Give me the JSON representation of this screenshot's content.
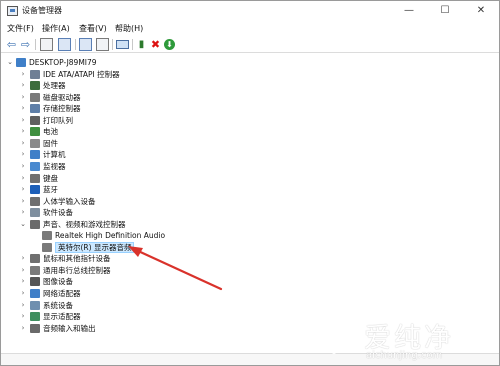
{
  "window": {
    "title": "设备管理器",
    "controls": {
      "minimize": "—",
      "maximize": "☐",
      "close": "✕"
    }
  },
  "menu": [
    "文件(F)",
    "操作(A)",
    "查看(V)",
    "帮助(H)"
  ],
  "toolbar": {
    "back_glyph": "⇦",
    "forward_glyph": "⇨",
    "uninstall_glyph": "✖",
    "update_glyph": "⬇"
  },
  "tree": {
    "root": {
      "label": "DESKTOP-J89MI79",
      "expanded": true
    },
    "categories": [
      {
        "label": "IDE ATA/ATAPI 控制器",
        "icon": "ide-controller-icon",
        "color": "#6f7f95",
        "expanded": false
      },
      {
        "label": "处理器",
        "icon": "processor-icon",
        "color": "#3d6e3d",
        "expanded": false
      },
      {
        "label": "磁盘驱动器",
        "icon": "disk-drive-icon",
        "color": "#7a7a7a",
        "expanded": false
      },
      {
        "label": "存储控制器",
        "icon": "storage-controller-icon",
        "color": "#5f7fa8",
        "expanded": false
      },
      {
        "label": "打印队列",
        "icon": "printer-icon",
        "color": "#606060",
        "expanded": false
      },
      {
        "label": "电池",
        "icon": "battery-icon",
        "color": "#3f8f3f",
        "expanded": false
      },
      {
        "label": "固件",
        "icon": "firmware-icon",
        "color": "#8a8a8a",
        "expanded": false
      },
      {
        "label": "计算机",
        "icon": "computer-icon",
        "color": "#3f7fc8",
        "expanded": false
      },
      {
        "label": "监视器",
        "icon": "monitor-icon",
        "color": "#4a8ad0",
        "expanded": false
      },
      {
        "label": "键盘",
        "icon": "keyboard-icon",
        "color": "#707070",
        "expanded": false
      },
      {
        "label": "蓝牙",
        "icon": "bluetooth-icon",
        "color": "#1d5fb8",
        "expanded": false
      },
      {
        "label": "人体学输入设备",
        "icon": "hid-icon",
        "color": "#6f6f6f",
        "expanded": false
      },
      {
        "label": "软件设备",
        "icon": "software-device-icon",
        "color": "#7f8f9f",
        "expanded": false
      },
      {
        "label": "声音、视频和游戏控制器",
        "icon": "sound-icon",
        "color": "#6a6a6a",
        "expanded": true,
        "children": [
          {
            "label": "Realtek High Definition Audio",
            "icon": "audio-device-icon",
            "color": "#7a7a7a",
            "selected": false
          },
          {
            "label": "英特尔(R) 显示器音频",
            "icon": "audio-device-icon",
            "color": "#7a7a7a",
            "selected": true
          }
        ]
      },
      {
        "label": "鼠标和其他指针设备",
        "icon": "mouse-icon",
        "color": "#6f6f6f",
        "expanded": false
      },
      {
        "label": "通用串行总线控制器",
        "icon": "usb-controller-icon",
        "color": "#7a7a7a",
        "expanded": false
      },
      {
        "label": "图像设备",
        "icon": "camera-icon",
        "color": "#555555",
        "expanded": false
      },
      {
        "label": "网络适配器",
        "icon": "network-adapter-icon",
        "color": "#3f7fc8",
        "expanded": false
      },
      {
        "label": "系统设备",
        "icon": "system-device-icon",
        "color": "#6f8faf",
        "expanded": false
      },
      {
        "label": "显示适配器",
        "icon": "display-adapter-icon",
        "color": "#3f8f5f",
        "expanded": false
      },
      {
        "label": "音频输入和输出",
        "icon": "audio-io-icon",
        "color": "#6a6a6a",
        "expanded": false
      }
    ]
  },
  "colors": {
    "annotation_arrow": "#d9322b",
    "selection": "#cce8ff"
  },
  "watermark": {
    "main": "爱纯净",
    "sub": "aichunjing.com"
  }
}
